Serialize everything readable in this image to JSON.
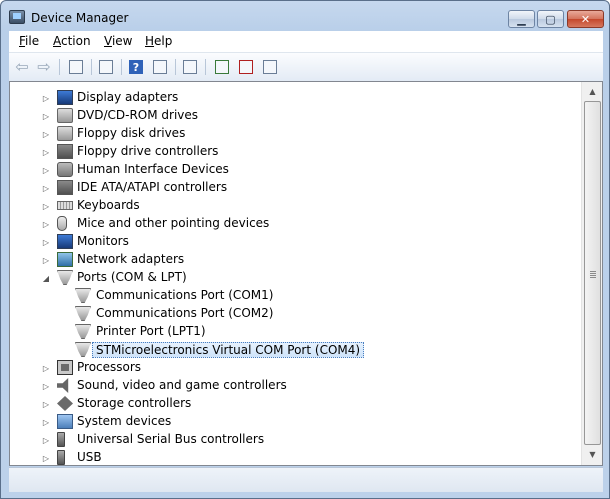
{
  "window": {
    "title": "Device Manager"
  },
  "caption_buttons": {
    "minimize": "▁",
    "maximize": "▢",
    "close": "✕"
  },
  "menu": [
    {
      "label": "File",
      "accel": "F",
      "rest": "ile"
    },
    {
      "label": "Action",
      "accel": "A",
      "rest": "ction"
    },
    {
      "label": "View",
      "accel": "V",
      "rest": "iew"
    },
    {
      "label": "Help",
      "accel": "H",
      "rest": "elp"
    }
  ],
  "toolbar": {
    "back_icon": "back-arrow-icon",
    "forward_icon": "forward-arrow-icon",
    "back_glyph": "⇦",
    "forward_glyph": "⇨",
    "help_glyph": "?"
  },
  "tree": [
    {
      "label": "Display adapters",
      "icon": "monitor-icon",
      "state": "collapsed"
    },
    {
      "label": "DVD/CD-ROM drives",
      "icon": "disc-drive-icon",
      "state": "collapsed"
    },
    {
      "label": "Floppy disk drives",
      "icon": "floppy-drive-icon",
      "state": "collapsed"
    },
    {
      "label": "Floppy drive controllers",
      "icon": "controller-icon",
      "state": "collapsed"
    },
    {
      "label": "Human Interface Devices",
      "icon": "hid-icon",
      "state": "collapsed"
    },
    {
      "label": "IDE ATA/ATAPI controllers",
      "icon": "ide-controller-icon",
      "state": "collapsed"
    },
    {
      "label": "Keyboards",
      "icon": "keyboard-icon",
      "state": "collapsed"
    },
    {
      "label": "Mice and other pointing devices",
      "icon": "mouse-icon",
      "state": "collapsed"
    },
    {
      "label": "Monitors",
      "icon": "monitor-icon",
      "state": "collapsed"
    },
    {
      "label": "Network adapters",
      "icon": "network-adapter-icon",
      "state": "collapsed"
    },
    {
      "label": "Ports (COM & LPT)",
      "icon": "port-icon",
      "state": "expanded"
    },
    {
      "label": "Communications Port (COM1)",
      "icon": "port-icon",
      "state": "child"
    },
    {
      "label": "Communications Port (COM2)",
      "icon": "port-icon",
      "state": "child"
    },
    {
      "label": "Printer Port (LPT1)",
      "icon": "port-icon",
      "state": "child"
    },
    {
      "label": "STMicroelectronics Virtual COM Port (COM4)",
      "icon": "port-icon",
      "state": "child-selected"
    },
    {
      "label": "Processors",
      "icon": "processor-icon",
      "state": "collapsed"
    },
    {
      "label": "Sound, video and game controllers",
      "icon": "speaker-icon",
      "state": "collapsed"
    },
    {
      "label": "Storage controllers",
      "icon": "storage-icon",
      "state": "collapsed"
    },
    {
      "label": "System devices",
      "icon": "system-device-icon",
      "state": "collapsed"
    },
    {
      "label": "Universal Serial Bus controllers",
      "icon": "usb-icon",
      "state": "collapsed"
    },
    {
      "label": "USB",
      "icon": "usb-icon",
      "state": "collapsed"
    }
  ],
  "glyphs": {
    "collapsed": "▷",
    "expanded": "◢",
    "scroll_up": "▲",
    "scroll_down": "▼"
  },
  "colors": {
    "selection_border": "#4a7fc0",
    "selection_fill": "#cfe4fa"
  }
}
